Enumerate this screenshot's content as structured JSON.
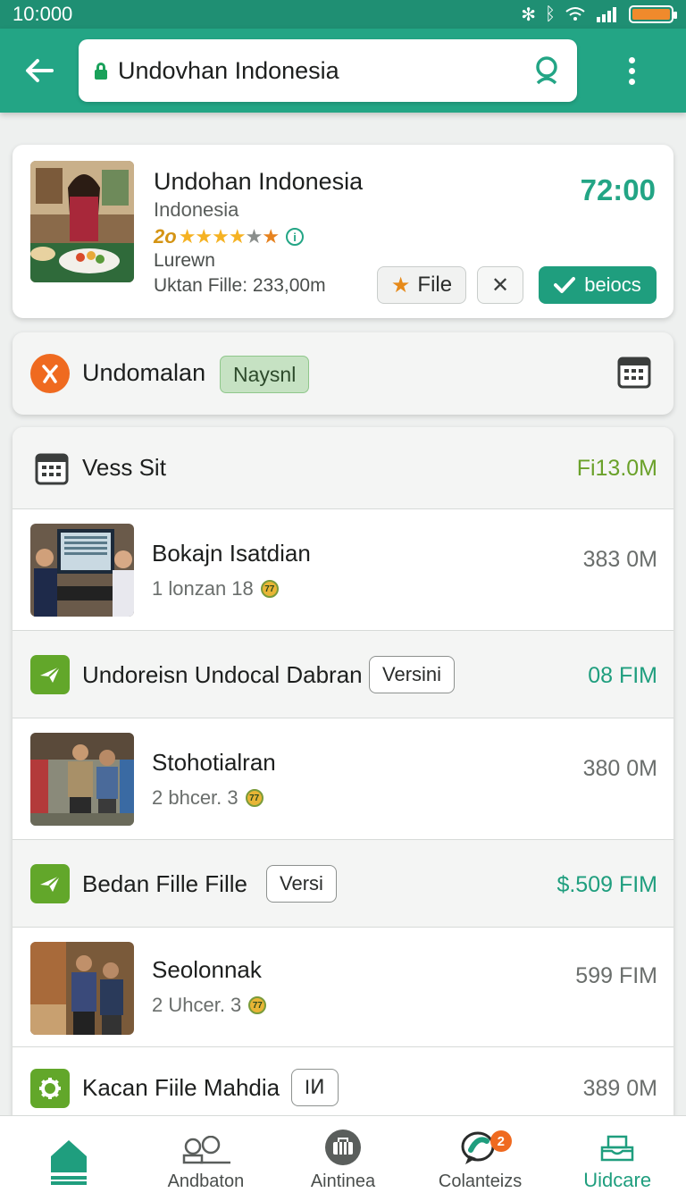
{
  "status_bar": {
    "time": "10:000",
    "icons": [
      "bluetooth-icon",
      "bluetooth-icon",
      "wifi-icon",
      "signal-icon",
      "battery-icon"
    ],
    "battery_color": "#f08a2c"
  },
  "app_bar": {
    "search_text": "Undovhan Indonesia",
    "accent": "#23a585"
  },
  "top_card": {
    "title": "Undohan Indonesia",
    "subtitle": "Indonesia",
    "rating_text": "2o",
    "stars": "★★★★★",
    "line4": "Lurewn",
    "line5": "Uktan Fille: 233,00m",
    "price": "72:00",
    "file_button": "File",
    "confirm_button": "beiocs"
  },
  "filter_card": {
    "label": "Undomalan",
    "badge": "Naysnl"
  },
  "list": {
    "header": {
      "title": "Vess Sit",
      "value": "Fi13.0M"
    },
    "rows": [
      {
        "type": "item",
        "title": "Bokajn Isatdian",
        "sub": "1 lonzan 18",
        "value": "383 0M"
      },
      {
        "type": "group",
        "title": "Undoreisn Undocal Dabran",
        "tag": "Versini",
        "value": "08 FIM"
      },
      {
        "type": "item",
        "title": "Stohotialran",
        "sub": "2 bhcer. 3",
        "value": "380 0M"
      },
      {
        "type": "group",
        "title": "Bedan Fille Fille",
        "tag": "Versi",
        "value": "$.509 FIM"
      },
      {
        "type": "item",
        "title": "Seolonnak",
        "sub": "2 Uhcer. 3",
        "value": "599 FIM"
      },
      {
        "type": "group",
        "title": "Kacan Fiile Mahdia",
        "tag": "IͶ",
        "value": "389 0M"
      }
    ]
  },
  "bottom_nav": {
    "items": [
      {
        "label": "",
        "icon": "home-icon"
      },
      {
        "label": "Andbaton",
        "icon": "people-icon"
      },
      {
        "label": "Aintinea",
        "icon": "briefcase-icon"
      },
      {
        "label": "Colanteizs",
        "icon": "chat-icon",
        "badge": "2"
      },
      {
        "label": "Uidcare",
        "icon": "tray-icon"
      }
    ]
  }
}
